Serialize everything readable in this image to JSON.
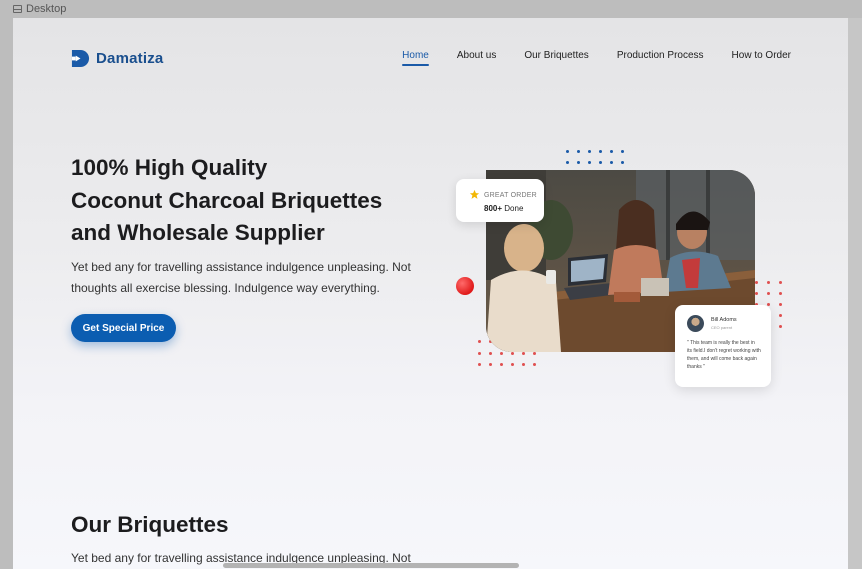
{
  "frame": {
    "label": "Desktop",
    "icon": "frame-icon"
  },
  "brand": {
    "name": "Damatiza",
    "icon": "logo-d-icon",
    "color": "#1a4f8e"
  },
  "nav": {
    "items": [
      {
        "label": "Home",
        "active": true
      },
      {
        "label": "About us"
      },
      {
        "label": "Our Briquettes"
      },
      {
        "label": "Production Process"
      },
      {
        "label": "How to Order"
      }
    ]
  },
  "hero": {
    "title_line1": "100% High Quality",
    "title_line2": "Coconut Charcoal Briquettes",
    "title_line3": "and Wholesale Supplier",
    "subtitle": "Yet bed any for travelling assistance indulgence unpleasing. Not thoughts all exercise blessing. Indulgence way everything.",
    "cta_label": "Get Special Price"
  },
  "order_card": {
    "icon": "star-icon",
    "label": "GREAT ORDER",
    "count": "800+",
    "count_suffix": "Done"
  },
  "review_card": {
    "name": "Bill Adoms",
    "role": "CEO parent",
    "quote": "\" This team is really the best in its field.I don't regret working with them, and will come back again thanks \""
  },
  "section": {
    "title": "Our Briquettes",
    "subtitle": "Yet bed any for travelling assistance indulgence unpleasing. Not"
  },
  "colors": {
    "primary": "#0b5db1",
    "accent_red": "#e01a1a",
    "dots_red": "#e05050",
    "dots_blue": "#1a5aa8"
  }
}
